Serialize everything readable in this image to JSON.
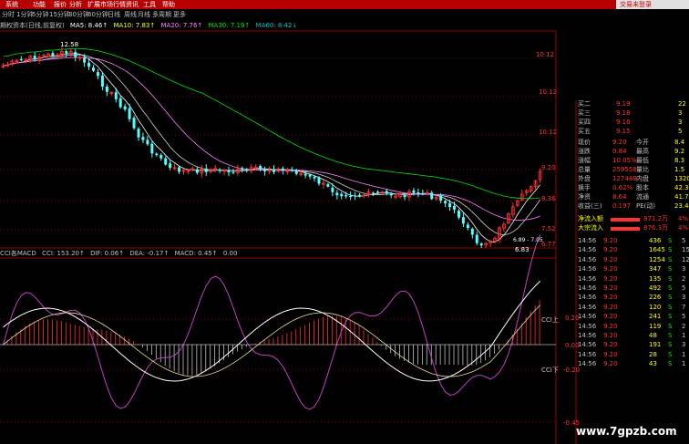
{
  "menu": {
    "items": [
      "系统",
      "功能",
      "报价",
      "分析",
      "扩展市场行情",
      "资讯",
      "工具",
      "帮助"
    ],
    "right_label": "交易未登录"
  },
  "period_tabs": [
    "分时",
    "1分钟",
    "5分钟",
    "15分钟",
    "30分钟",
    "60分钟",
    "日线",
    "周线",
    "月线",
    "多周期",
    "更多"
  ],
  "main_legend": {
    "title": "期权资本(日线,前复权)",
    "ma5": "MA5: 8.46↑",
    "ma10": "MA10: 7.83↑",
    "ma20": "MA20: 7.76↑",
    "ma30": "MA30: 7.19↑",
    "ma60": "MA60: 8.42↓"
  },
  "price_axis": [
    "10.12",
    "9.20",
    "8.36",
    "7.52",
    "6.77"
  ],
  "annotations": {
    "high": "12.58",
    "low": "6.83",
    "range": "6.89 - 7.05"
  },
  "indicator_legend": {
    "title": "CCI各MACD",
    "cci": "CCI: 153.20↑",
    "dif": "DIF: 0.06↑",
    "dea": "DEA: -0.17↑",
    "macd": "MACD: 0.45↑",
    "extra": "0.00"
  },
  "indicator_axis": [
    "0.20",
    "0.00",
    "-0.20",
    "-0.45"
  ],
  "indicator_labels": {
    "cci_up": "CCI上",
    "cci_down": "CCI下"
  },
  "colors": {
    "up": "#ff3232",
    "down": "#54ffff",
    "ma5": "#ffffff",
    "ma10": "#ffff00",
    "ma20": "#ff80ff",
    "ma30": "#00e600",
    "accent": "#b40000"
  },
  "quote": {
    "bids": [
      {
        "label": "买二",
        "price": "9.19",
        "vol": "22"
      },
      {
        "label": "买三",
        "price": "9.18",
        "vol": "3"
      },
      {
        "label": "买四",
        "price": "9.16",
        "vol": "3"
      },
      {
        "label": "买五",
        "price": "9.15",
        "vol": "5"
      }
    ],
    "stats": [
      {
        "l1": "现价",
        "v1": "9.20",
        "l2": "今开",
        "v2": "8.4"
      },
      {
        "l1": "涨跌",
        "v1": "0.84",
        "l2": "最高",
        "v2": "9.2"
      },
      {
        "l1": "涨幅",
        "v1": "10.05%",
        "l2": "最低",
        "v2": "8.3"
      },
      {
        "l1": "总量",
        "v1": "259558",
        "l2": "量比",
        "v2": "1.5"
      },
      {
        "l1": "外盘",
        "v1": "127488",
        "l2": "内盘",
        "v2": "13208"
      },
      {
        "l1": "换手",
        "v1": "0.62%",
        "l2": "股本",
        "v2": "42.3"
      },
      {
        "l1": "净资",
        "v1": "8.64",
        "l2": "流通",
        "v2": "41.7"
      },
      {
        "l1": "收益(三)",
        "v1": "0.197",
        "l2": "PE(动)",
        "v2": "23.4"
      }
    ],
    "flows": [
      {
        "label": "净流入额",
        "value": "871.2万",
        "pct": "4%"
      },
      {
        "label": "大宗流入",
        "value": "876.3万",
        "pct": "4%"
      }
    ]
  },
  "ticks": [
    {
      "time": "14:56",
      "price": "9.20",
      "vol": "436",
      "side": "S",
      "n": "5"
    },
    {
      "time": "14:56",
      "price": "9.20",
      "vol": "1645",
      "side": "S",
      "n": "15"
    },
    {
      "time": "14:56",
      "price": "9.20",
      "vol": "1254",
      "side": "S",
      "n": "12"
    },
    {
      "time": "14:56",
      "price": "9.20",
      "vol": "347",
      "side": "S",
      "n": "3"
    },
    {
      "time": "14:56",
      "price": "9.20",
      "vol": "135",
      "side": "S",
      "n": "2"
    },
    {
      "time": "14:56",
      "price": "9.20",
      "vol": "492",
      "side": "S",
      "n": "5"
    },
    {
      "time": "14:56",
      "price": "9.20",
      "vol": "226",
      "side": "S",
      "n": "3"
    },
    {
      "time": "14:56",
      "price": "9.20",
      "vol": "120",
      "side": "S",
      "n": "7"
    },
    {
      "time": "14:56",
      "price": "9.20",
      "vol": "241",
      "side": "S",
      "n": "5"
    },
    {
      "time": "14:56",
      "price": "9.20",
      "vol": "119",
      "side": "S",
      "n": "2"
    },
    {
      "time": "14:56",
      "price": "9.20",
      "vol": "48",
      "side": "S",
      "n": "1"
    },
    {
      "time": "14:56",
      "price": "9.20",
      "vol": "191",
      "side": "S",
      "n": "3"
    },
    {
      "time": "14:56",
      "price": "9.20",
      "vol": "28",
      "side": "S",
      "n": "1"
    },
    {
      "time": "14:56",
      "price": "9.20",
      "vol": "43",
      "side": "S",
      "n": "1"
    }
  ],
  "watermark": "www.7gpzb.com"
}
